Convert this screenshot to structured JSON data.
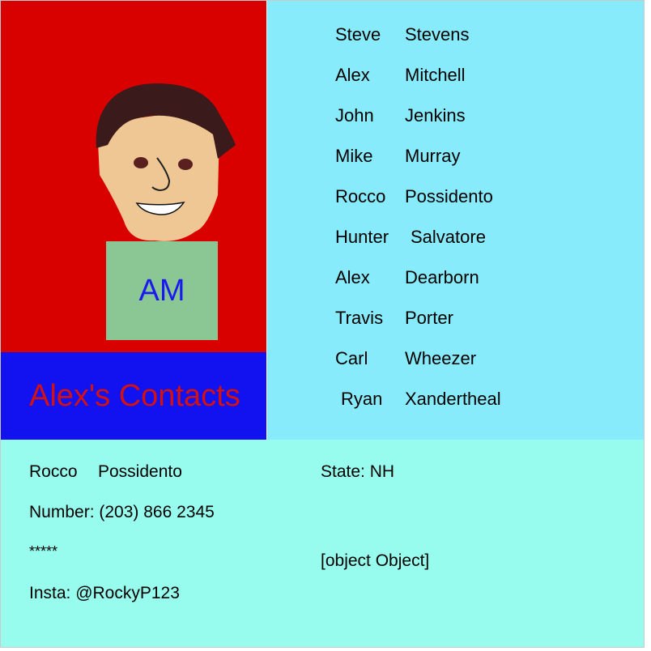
{
  "header": {
    "title": "Alex's Contacts",
    "avatar_initials": "AM"
  },
  "colors": {
    "avatar_panel": "#d90000",
    "title_panel": "#1212f0",
    "title_text": "#d41111",
    "contacts_panel": "#87ebfb",
    "detail_panel": "#97fcee",
    "shirt": "#8ac794",
    "initials_text": "#1a1aee",
    "skin": "#efc794",
    "hair": "#3a1a1a"
  },
  "contacts": [
    {
      "first": "Steve",
      "last": "Stevens"
    },
    {
      "first": "Alex",
      "last": "Mitchell"
    },
    {
      "first": "John",
      "last": "Jenkins"
    },
    {
      "first": "Mike",
      "last": "Murray"
    },
    {
      "first": "Rocco",
      "last": "Possidento"
    },
    {
      "first": "Hunter",
      "last": "Salvatore"
    },
    {
      "first": "Alex",
      "last": "Dearborn"
    },
    {
      "first": "Travis",
      "last": "Porter"
    },
    {
      "first": "Carl",
      "last": "Wheezer"
    },
    {
      "first": "Ryan",
      "last": "Xandertheal"
    }
  ],
  "detail": {
    "first": "Rocco",
    "last": "Possidento",
    "number": "Number: (203) 866 2345",
    "masked": "*****",
    "insta": "Insta: @RockyP123",
    "state": "State: NH",
    "object_text": "[object Object]"
  }
}
